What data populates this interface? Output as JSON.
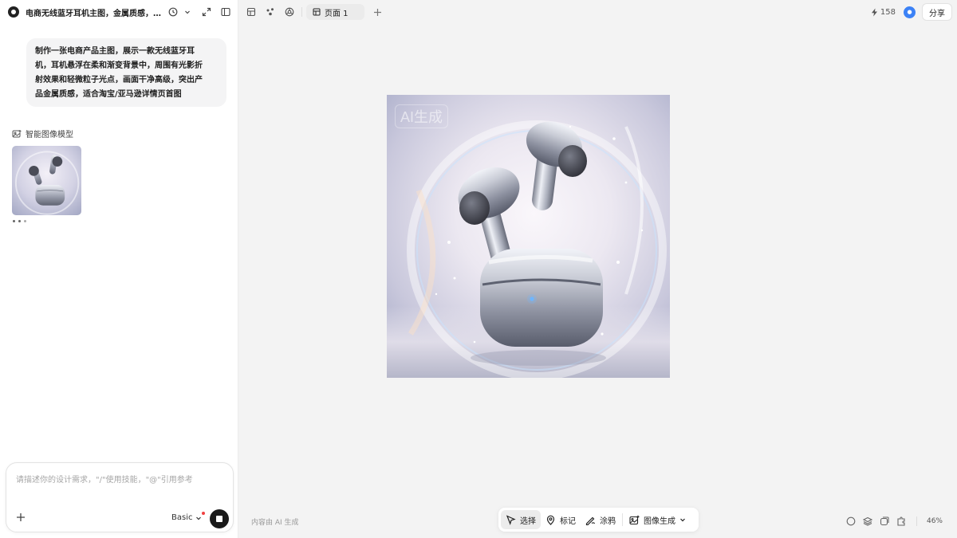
{
  "header": {
    "title": "电商无线蓝牙耳机主图，金属质感，高级感",
    "icons": [
      "history-icon",
      "chevron-down-icon",
      "expand-icon",
      "sidebar-toggle-icon"
    ]
  },
  "chat": {
    "user_message_lines": [
      "制作一张电商产品主图，展示一款无线蓝牙耳",
      "机，耳机悬浮在柔和渐变背景中，周围有光影折",
      "射效果和轻微粒子光点，画面干净高级，突出产",
      "品金属质感，适合淘宝/亚马逊详情页首图"
    ],
    "model_label": "智能图像模型"
  },
  "input": {
    "placeholder": "请描述你的设计需求，\"/\"使用技能，\"@\"引用参考",
    "mode_label": "Basic"
  },
  "topbar": {
    "tab_label": "页面 1",
    "credits": "158",
    "share_label": "分享"
  },
  "canvas": {
    "watermark": "AI生成",
    "footer_note": "内容由 AI 生成"
  },
  "toolbar": {
    "select_label": "选择",
    "mark_label": "标记",
    "draw_label": "涂鸦",
    "image_gen_label": "图像生成"
  },
  "zoom": "46%",
  "colors": {
    "accent": "#3c82f6",
    "stop_button": "#1a1a1a",
    "notify_dot": "#f04040"
  }
}
